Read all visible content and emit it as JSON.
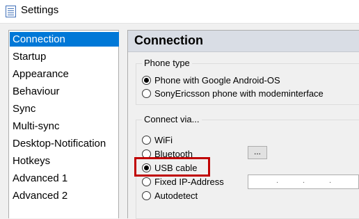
{
  "window": {
    "title": "Settings"
  },
  "sidebar": {
    "items": [
      {
        "label": "Connection",
        "selected": true
      },
      {
        "label": "Startup"
      },
      {
        "label": "Appearance"
      },
      {
        "label": "Behaviour"
      },
      {
        "label": "Sync"
      },
      {
        "label": "Multi-sync"
      },
      {
        "label": "Desktop-Notification"
      },
      {
        "label": "Hotkeys"
      },
      {
        "label": "Advanced 1"
      },
      {
        "label": "Advanced 2"
      }
    ]
  },
  "panel": {
    "title": "Connection",
    "phone_type": {
      "legend": "Phone type",
      "options": [
        {
          "label": "Phone with Google Android-OS",
          "checked": true
        },
        {
          "label": "SonyEricsson phone with modeminterface",
          "checked": false
        }
      ]
    },
    "connect_via": {
      "legend": "Connect via...",
      "options": [
        {
          "label": "WiFi",
          "checked": false
        },
        {
          "label": "Bluetooth",
          "checked": false
        },
        {
          "label": "USB cable",
          "checked": true
        },
        {
          "label": "Fixed IP-Address",
          "checked": false
        },
        {
          "label": "Autodetect",
          "checked": false
        }
      ],
      "bluetooth_browse_label": "...",
      "ip_separator": "."
    }
  },
  "colors": {
    "selection": "#0078d7",
    "highlight": "#c00000",
    "header": "#d9dde5"
  }
}
